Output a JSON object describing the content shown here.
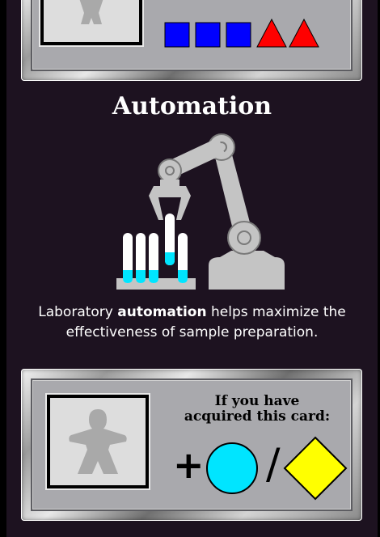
{
  "card": {
    "title": "Automation",
    "description_prefix": "Laboratory ",
    "description_bold": "automation",
    "description_suffix": " helps maximize the effectiveness of sample preparation.",
    "background_color": "#1d1220"
  },
  "cost_panel": {
    "cost_icons": [
      "blue-square",
      "blue-square",
      "blue-square",
      "red-triangle",
      "red-triangle"
    ],
    "colors": {
      "square": "#0000ff",
      "triangle": "#ff0000"
    }
  },
  "reward_panel": {
    "heading_line1": "If you have",
    "heading_line2": "acquired this card:",
    "plus_symbol": "+",
    "separator": "/",
    "reward_icons": [
      "cyan-circle",
      "yellow-diamond"
    ],
    "colors": {
      "circle": "#00e5ff",
      "diamond": "#ffff00"
    }
  },
  "illustration": {
    "icon": "robot-arm-test-tubes-icon",
    "colors": {
      "robot": "#c4c4c4",
      "liquid": "#00e5ff"
    }
  }
}
